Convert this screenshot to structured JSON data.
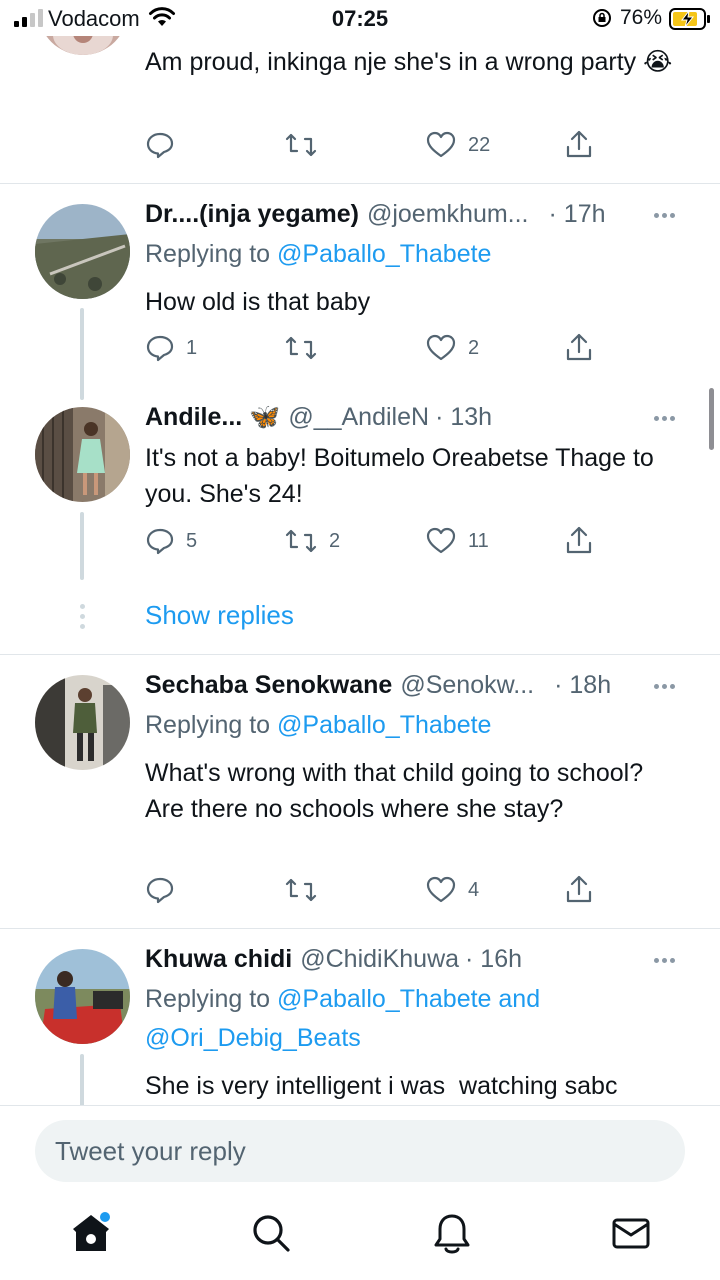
{
  "status_bar": {
    "carrier": "Vodacom",
    "time": "07:25",
    "battery": "76%"
  },
  "tweets": [
    {
      "text": "Am proud, inkinga nje she's in a wrong party 😭",
      "actions": {
        "replies": "",
        "retweets": "",
        "likes": "22"
      }
    },
    {
      "name": "Dr....(inja yegame)",
      "handle": "@joemkhum...",
      "time": "· 17h",
      "replying_prefix": "Replying to ",
      "replying_to": "@Paballo_Thabete",
      "text": "How old is that baby",
      "actions": {
        "replies": "1",
        "retweets": "",
        "likes": "2"
      }
    },
    {
      "name": "Andile... 🦋",
      "handle": "@__AndileN",
      "time": "· 13h",
      "text": "It's not a baby! Boitumelo Oreabetse Thage to you. She's 24!",
      "actions": {
        "replies": "5",
        "retweets": "2",
        "likes": "11"
      }
    },
    {
      "name": "Sechaba Senokwane",
      "handle": "@Senokw...",
      "time": "· 18h",
      "replying_prefix": "Replying to ",
      "replying_to": "@Paballo_Thabete",
      "text": "What's wrong with that child going to school? Are there no schools where she stay?",
      "actions": {
        "replies": "",
        "retweets": "",
        "likes": "4"
      }
    },
    {
      "name": "Khuwa chidi",
      "handle": "@ChidiKhuwa",
      "time": "· 16h",
      "replying_prefix": "Replying to ",
      "replying_to": "@Paballo_Thabete and",
      "replying_to_2": "@Ori_Debig_Beats",
      "text": "She is very intelligent i was  watching sabc"
    }
  ],
  "show_replies": "Show replies",
  "reply_placeholder": "Tweet your reply",
  "nav": [
    "home-icon",
    "search-icon",
    "notifications-icon",
    "messages-icon"
  ],
  "colors": {
    "accent": "#1d9bf0",
    "muted": "#536471",
    "text": "#0f1419"
  }
}
